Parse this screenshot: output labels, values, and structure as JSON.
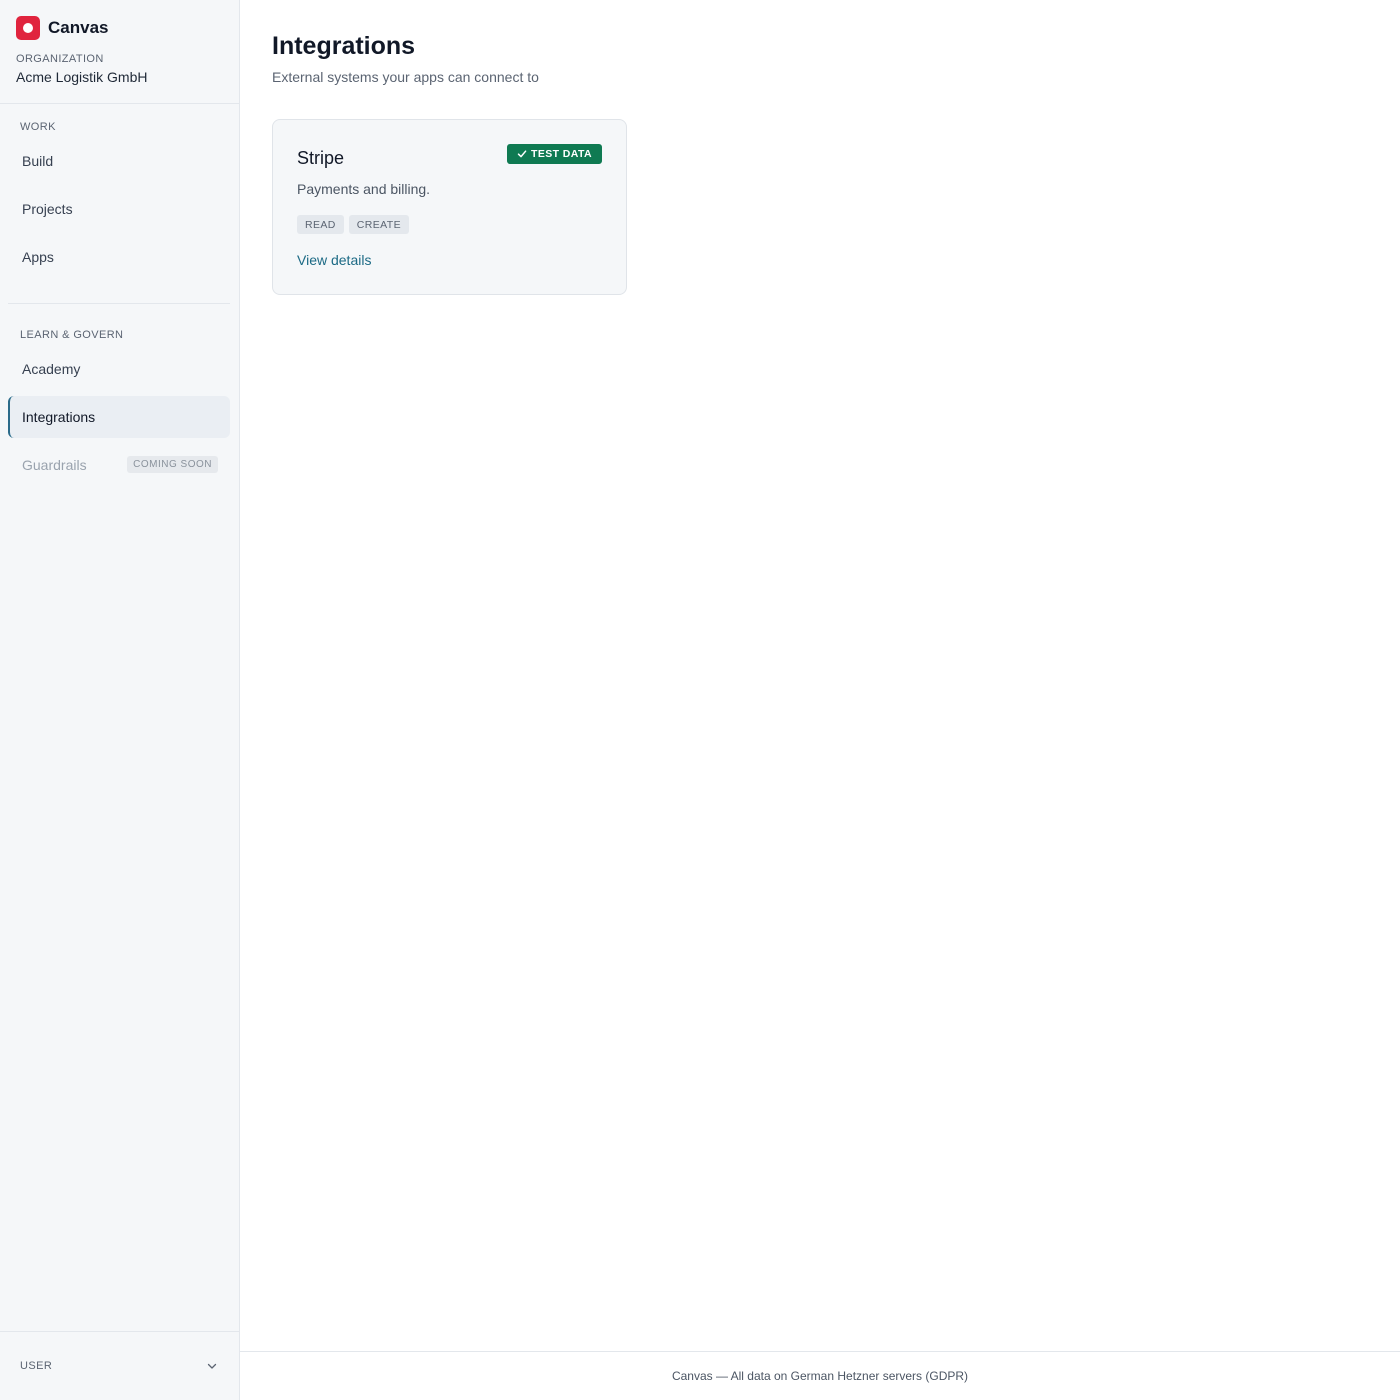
{
  "app": {
    "name": "Canvas",
    "logo_icon": "canvas-logo-icon",
    "brand_color": "#e0243e"
  },
  "organization": {
    "label": "ORGANIZATION",
    "name": "Acme Logistik GmbH"
  },
  "sidebar": {
    "sections": [
      {
        "label": "WORK",
        "items": [
          {
            "label": "Build"
          },
          {
            "label": "Projects"
          },
          {
            "label": "Apps"
          }
        ]
      },
      {
        "label": "LEARN & GOVERN",
        "items": [
          {
            "label": "Academy"
          },
          {
            "label": "Integrations",
            "active": true
          },
          {
            "label": "Guardrails",
            "disabled": true,
            "badge": "COMING SOON"
          }
        ]
      }
    ],
    "user": {
      "label": "USER",
      "icon": "chevron-down-icon"
    }
  },
  "main": {
    "title": "Integrations",
    "subtitle": "External systems your apps can connect to",
    "cards": [
      {
        "title": "Stripe",
        "badge": "TEST DATA",
        "badge_icon": "check-icon",
        "badge_color": "#0f7a52",
        "description": "Payments and billing.",
        "tags": [
          "READ",
          "CREATE"
        ],
        "link": "View details"
      }
    ]
  },
  "footer": {
    "text": "Canvas — All data on German Hetzner servers (GDPR)"
  }
}
